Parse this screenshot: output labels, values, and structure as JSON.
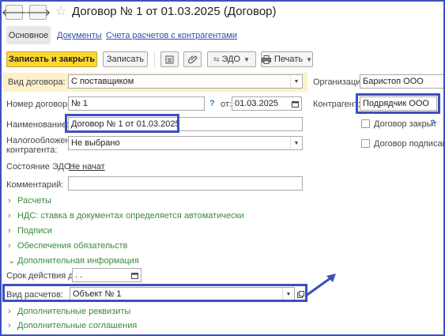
{
  "window": {
    "title": "Договор № 1 от 01.03.2025 (Договор)"
  },
  "nav": {
    "back": "🡐",
    "forward": "🡒",
    "star": "☆"
  },
  "tabs": {
    "active": "Основное",
    "links": [
      "Документы",
      "Счета расчетов с контрагентами"
    ]
  },
  "toolbar": {
    "save_close": "Записать и закрыть",
    "save": "Записать",
    "edo": "ЭДО",
    "print": "Печать"
  },
  "form": {
    "contract_type": {
      "label": "Вид договора:",
      "value": "С поставщиком"
    },
    "number": {
      "label": "Номер договора:",
      "value": "№ 1",
      "help": "?",
      "from_label": "от:",
      "date": "01.03.2025"
    },
    "name": {
      "label": "Наименование:",
      "value": "Договор № 1 от 01.03.2025"
    },
    "tax": {
      "label_line1": "Налогообложение",
      "label_line2": "контрагента:",
      "value": "Не выбрано"
    },
    "edo_state": {
      "label": "Состояние ЭДО:",
      "value": "Не начат"
    },
    "comment": {
      "label": "Комментарий:",
      "value": ""
    },
    "organization": {
      "label": "Организация:",
      "value": "Баристоп ООО"
    },
    "counterparty": {
      "label": "Контрагент:",
      "value": "Подрядчик ООО"
    },
    "closed": {
      "label": "Договор закрыт",
      "help": "?",
      "checked": false
    },
    "signed": {
      "label": "Договор подписан",
      "checked": false
    },
    "validity": {
      "label": "Срок действия до:",
      "value": " .  ."
    },
    "settlement_type": {
      "label": "Вид расчетов:",
      "value": "Объект № 1"
    }
  },
  "groups": {
    "payments": "Расчеты",
    "vat": "НДС: ставка в документах определяется автоматически",
    "signatures": "Подписи",
    "obligations": "Обеспечения обязательств",
    "additional_info": "Дополнительная информация",
    "additional_requisites": "Дополнительные реквизиты",
    "additional_agreements": "Дополнительные соглашения"
  },
  "colors": {
    "highlight": "#3d4fc0",
    "primary_button": "#fbd532",
    "group_link": "#3a8a3a",
    "tab_link": "#2a4dac"
  },
  "icons": [
    "back-arrow-icon",
    "forward-arrow-icon",
    "star-icon",
    "list-icon",
    "paperclip-icon",
    "printer-icon",
    "calendar-icon",
    "open-icon"
  ]
}
